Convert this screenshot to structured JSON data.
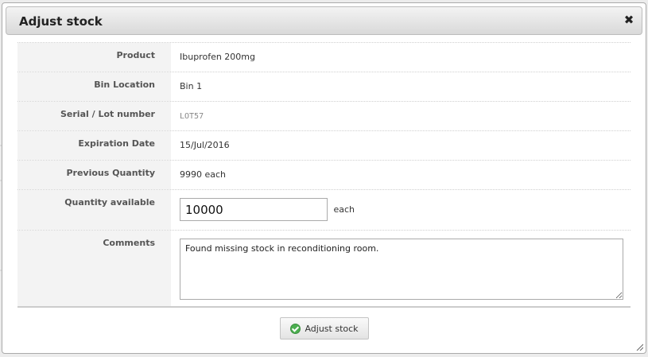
{
  "dialog": {
    "title": "Adjust stock",
    "close_icon": "close-icon"
  },
  "fields": {
    "product": {
      "label": "Product",
      "value": "Ibuprofen 200mg"
    },
    "bin_location": {
      "label": "Bin Location",
      "value": "Bin 1"
    },
    "lot_number": {
      "label": "Serial / Lot number",
      "value": "LOT57"
    },
    "expiration_date": {
      "label": "Expiration Date",
      "value": "15/Jul/2016"
    },
    "previous_quantity": {
      "label": "Previous Quantity",
      "value": "9990 each"
    },
    "quantity_available": {
      "label": "Quantity available",
      "value": "10000",
      "unit": "each"
    },
    "comments": {
      "label": "Comments",
      "value": "Found missing stock in reconditioning room."
    }
  },
  "actions": {
    "submit_label": "Adjust stock",
    "submit_icon": "check-circle-icon"
  },
  "colors": {
    "accent_green": "#4caf50",
    "label_background": "#f3f3f3"
  }
}
